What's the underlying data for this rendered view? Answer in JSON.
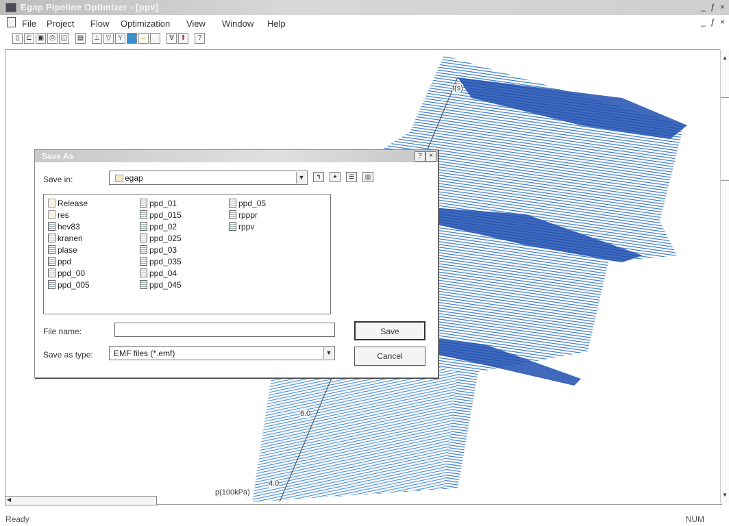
{
  "window": {
    "title": "Egap Pipeline Optimizer - [ppv]",
    "min_max_close": "_ ƒ ×"
  },
  "menu": [
    "File",
    "Project",
    "Flow",
    "Optimization",
    "View",
    "Window",
    "Help"
  ],
  "toolbar": {
    "icons": [
      "new-icon",
      "open-icon",
      "save-icon",
      "print-icon",
      "print-preview-icon",
      "copy-icon",
      "project-icon",
      "filter-icon",
      "flow-icon",
      "color-map-icon",
      "pump-icon",
      "blank-icon",
      "optimize-icon",
      "up-icon",
      "help-icon"
    ]
  },
  "plot": {
    "label_top": "t(s)",
    "tick_60": "6.0",
    "tick_40": "4.0",
    "axis_label": "p(100kPa)",
    "mesh_color": "#2a6fc4"
  },
  "dialog": {
    "title": "Save As",
    "help_btn": "?",
    "close_btn": "×",
    "save_in_label": "Save in:",
    "save_in_value": "egap",
    "files_col1": [
      "Release",
      "res",
      "hev83",
      "kranen",
      "plase",
      "ppd",
      "ppd_00",
      "ppd_005"
    ],
    "files_col1_types": [
      "folder",
      "folder",
      "doc",
      "doc",
      "doc",
      "doc",
      "doc",
      "doc"
    ],
    "files_col2": [
      "ppd_01",
      "ppd_015",
      "ppd_02",
      "ppd_025",
      "ppd_03",
      "ppd_035",
      "ppd_04",
      "ppd_045"
    ],
    "files_col3": [
      "ppd_05",
      "rpppr",
      "rppv"
    ],
    "file_name_label": "File name:",
    "file_name_value": "",
    "save_type_label": "Save as type:",
    "save_type_value": "EMF files (*.emf)",
    "save_button": "Save",
    "cancel_button": "Cancel"
  },
  "status": {
    "left": "Ready",
    "right": "NUM"
  }
}
